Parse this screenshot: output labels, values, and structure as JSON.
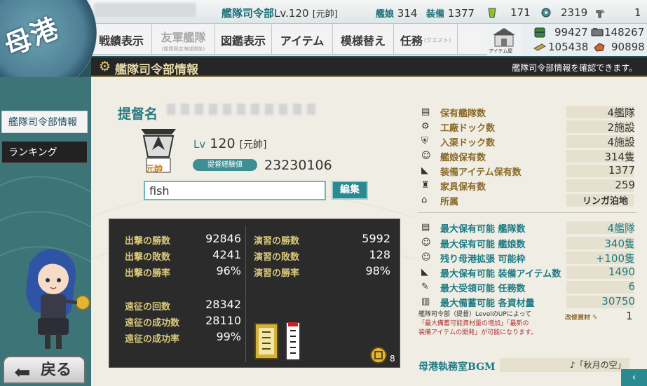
{
  "header": {
    "admiral_title": "艦隊司令部",
    "lv_prefix": "Lv.",
    "level": "120",
    "rank": "[元帥]",
    "ships_label": "艦娘",
    "ships_count": "314",
    "equip_label": "装備",
    "equip_count": "1377",
    "buckets": "171",
    "dev_mats": "2319",
    "improve_mats": "1"
  },
  "resources": {
    "fuel": "99427",
    "ammo": "148267",
    "steel": "105438",
    "bauxite": "90898"
  },
  "nav": {
    "items": [
      {
        "label": "戦績表示"
      },
      {
        "label": "友軍艦隊",
        "sub": "(期間限定海域開放)"
      },
      {
        "label": "図鑑表示"
      },
      {
        "label": "アイテム"
      },
      {
        "label": "模様替え"
      },
      {
        "label": "任務",
        "sub": "(クエスト)"
      }
    ],
    "shop_label": "アイテム屋"
  },
  "emblem": "母港",
  "section": {
    "title": "艦隊司令部情報",
    "hint": "艦隊司令部情報を確認できます。"
  },
  "sidebar": {
    "hq": "艦隊司令部情報",
    "ranking": "ランキング",
    "back": "戻る"
  },
  "profile": {
    "name_label": "提督名",
    "lv_label": "Lv",
    "level": "120",
    "rank": "[元帥]",
    "rank_badge": "元帥",
    "exp_label": "提督経験値",
    "exp_value": "23230106",
    "comment": "fish",
    "edit_button": "編集"
  },
  "record": {
    "left": [
      {
        "label": "出撃の勝数",
        "value": "92846"
      },
      {
        "label": "出撃の敗数",
        "value": "4241"
      },
      {
        "label": "出撃の勝率",
        "value": "96%"
      }
    ],
    "right": [
      {
        "label": "演習の勝数",
        "value": "5992"
      },
      {
        "label": "演習の敗数",
        "value": "128"
      },
      {
        "label": "演習の勝率",
        "value": "98%"
      }
    ],
    "expedition": [
      {
        "label": "遠征の回数",
        "value": "28342"
      },
      {
        "label": "遠征の成功数",
        "value": "28110"
      },
      {
        "label": "遠征の成功率",
        "value": "99%"
      }
    ],
    "medal_count": "8"
  },
  "stats": [
    {
      "icon": "ship-icon",
      "label": "保有艦隊数",
      "value": "4艦隊"
    },
    {
      "icon": "gear-icon",
      "label": "工廠ドック数",
      "value": "2施設"
    },
    {
      "icon": "dock-icon",
      "label": "入渠ドック数",
      "value": "4施設"
    },
    {
      "icon": "girl-icon",
      "label": "艦娘保有数",
      "value": "314隻"
    },
    {
      "icon": "equip-icon",
      "label": "装備アイテム保有数",
      "value": "1377"
    },
    {
      "icon": "chair-icon",
      "label": "家具保有数",
      "value": "259"
    },
    {
      "icon": "base-icon",
      "label": "所属",
      "value": "リンガ泊地"
    }
  ],
  "max_stats": [
    {
      "icon": "ship-icon",
      "label": "最大保有可能 艦隊数",
      "value": "4艦隊"
    },
    {
      "icon": "girl-icon",
      "label": "最大保有可能 艦娘数",
      "value": "340隻"
    },
    {
      "icon": "girl-icon",
      "label": "残り母港拡張 可能枠",
      "value": "+100隻"
    },
    {
      "icon": "equip-icon",
      "label": "最大保有可能 装備アイテム数",
      "value": "1490"
    },
    {
      "icon": "quest-icon",
      "label": "最大受領可能 任務数",
      "value": "6"
    },
    {
      "icon": "storage-icon",
      "label": "最大備蓄可能 各資材量",
      "value": "30750"
    }
  ],
  "note": {
    "line1": "艦隊司令部（提督）LevelのUPによって",
    "line2": "「最大備蓄可能資材量の増加」「最新の",
    "line3": "装備アイテムの開発」が可能になります。",
    "kaizou_label": "改修資材",
    "kaizou_value": "1"
  },
  "bgm": {
    "label": "母港執務室BGM",
    "value": "♪「秋月の空」"
  },
  "colors": {
    "teal": "#1e7b84",
    "gold": "#8a6b2a",
    "panel": "#f0ede5",
    "dark": "#2b2b2b"
  }
}
